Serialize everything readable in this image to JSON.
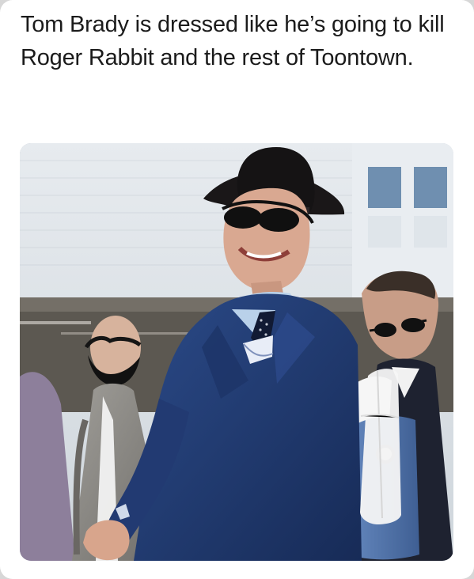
{
  "post": {
    "caption": "Tom Brady is dressed like he’s going to kill Roger Rabbit and the rest of Toontown."
  },
  "photo": {
    "colors": {
      "background_wall": "#d9dee3",
      "sky_window": "#7f9eb8",
      "suit_navy": "#223a72",
      "suit_grey": "#8f8d89",
      "hat_black": "#1a1718",
      "skin": "#d6a48b",
      "shirt_blue": "#b9d1ea",
      "jacket_blue": "#4b6ea4"
    }
  }
}
